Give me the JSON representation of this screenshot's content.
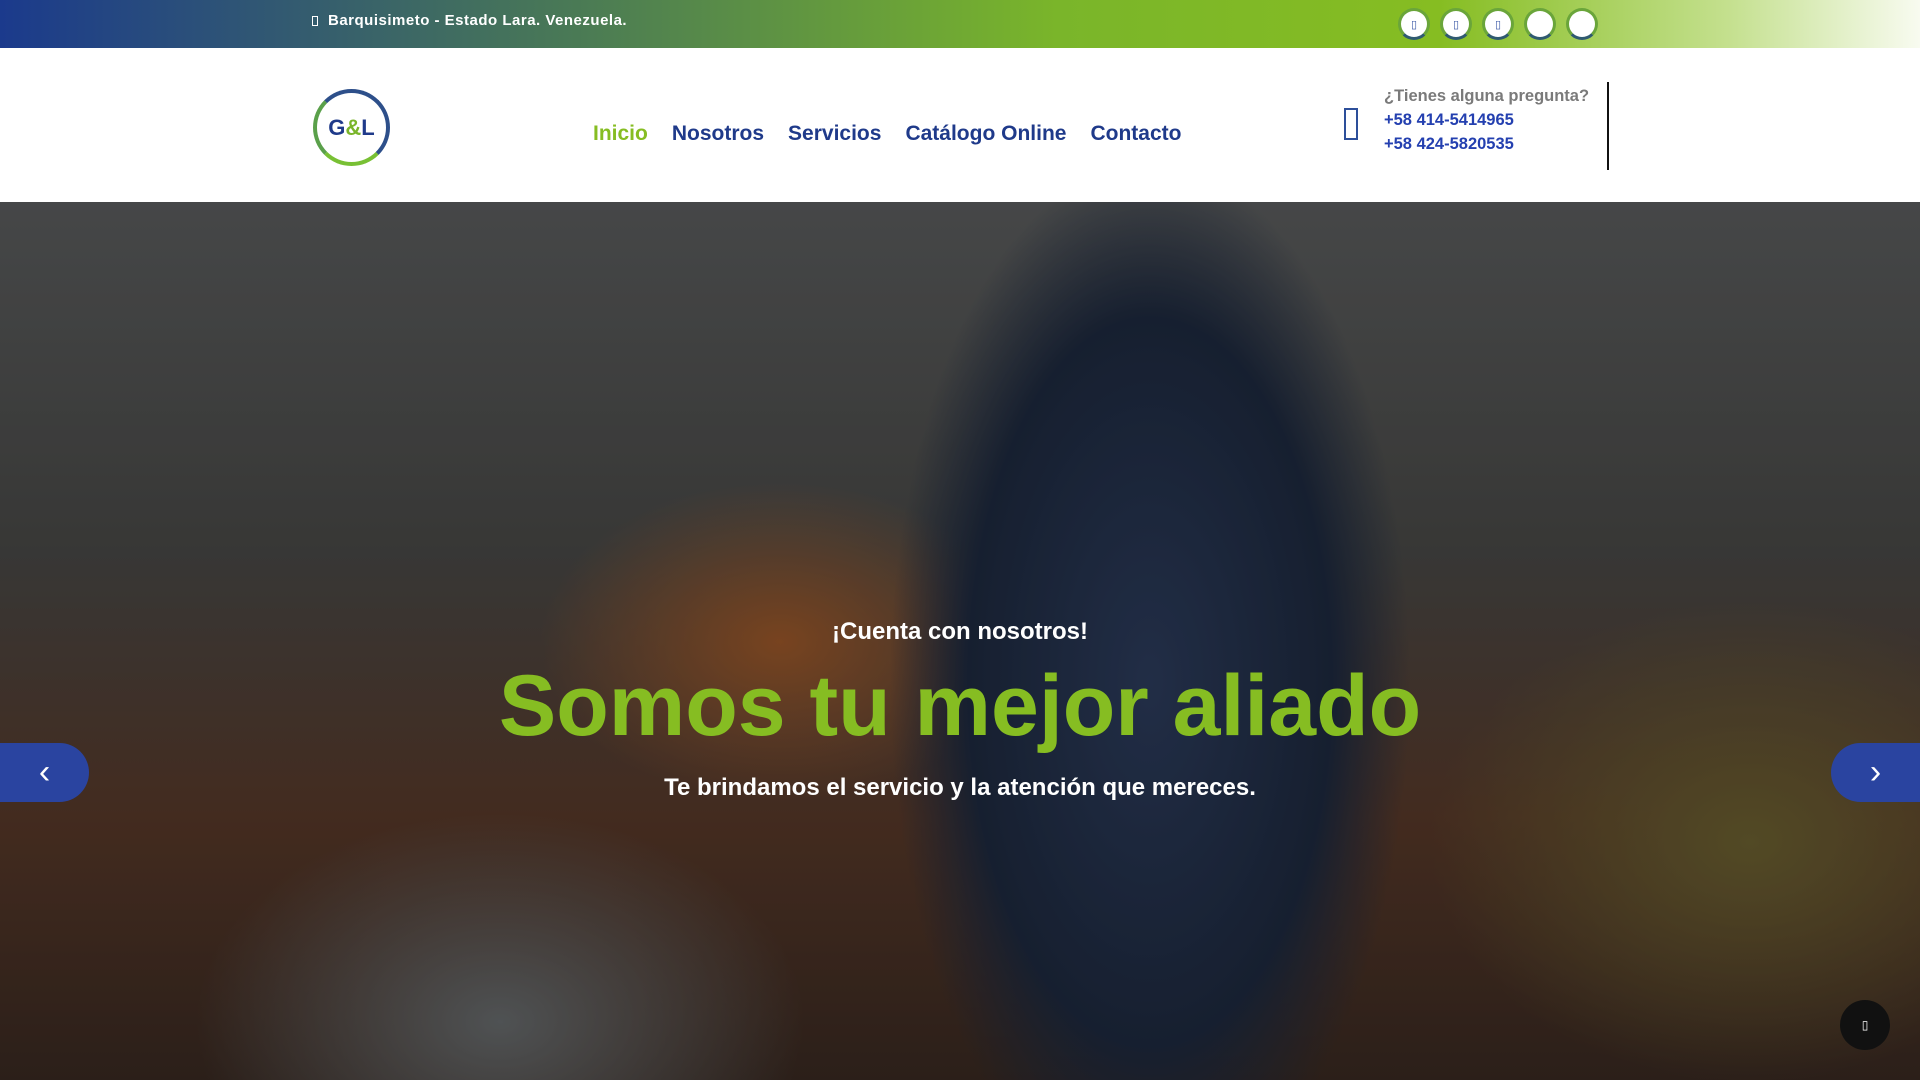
{
  "topbar": {
    "location": "Barquisimeto - Estado Lara. Venezuela.",
    "socials": [
      "facebook-icon",
      "instagram-icon",
      "twitter-icon",
      "whatsapp-icon",
      "youtube-icon"
    ]
  },
  "header": {
    "logo_text": "G&L",
    "nav": [
      "Inicio",
      "Nosotros",
      "Servicios",
      "Catálogo Online",
      "Contacto"
    ],
    "contact": {
      "question": "¿Tienes alguna pregunta?",
      "phone1": "+58 414-5414965",
      "phone2": "+58 424-5820535"
    }
  },
  "hero": {
    "eyebrow": "¡Cuenta con nosotros!",
    "title": "Somos tu mejor aliado",
    "subtitle": "Te brindamos el servicio y la atención que mereces.",
    "prev": "‹",
    "next": "›"
  },
  "colors": {
    "brand_blue": "#1f3a8a",
    "brand_green": "#86bd22"
  }
}
